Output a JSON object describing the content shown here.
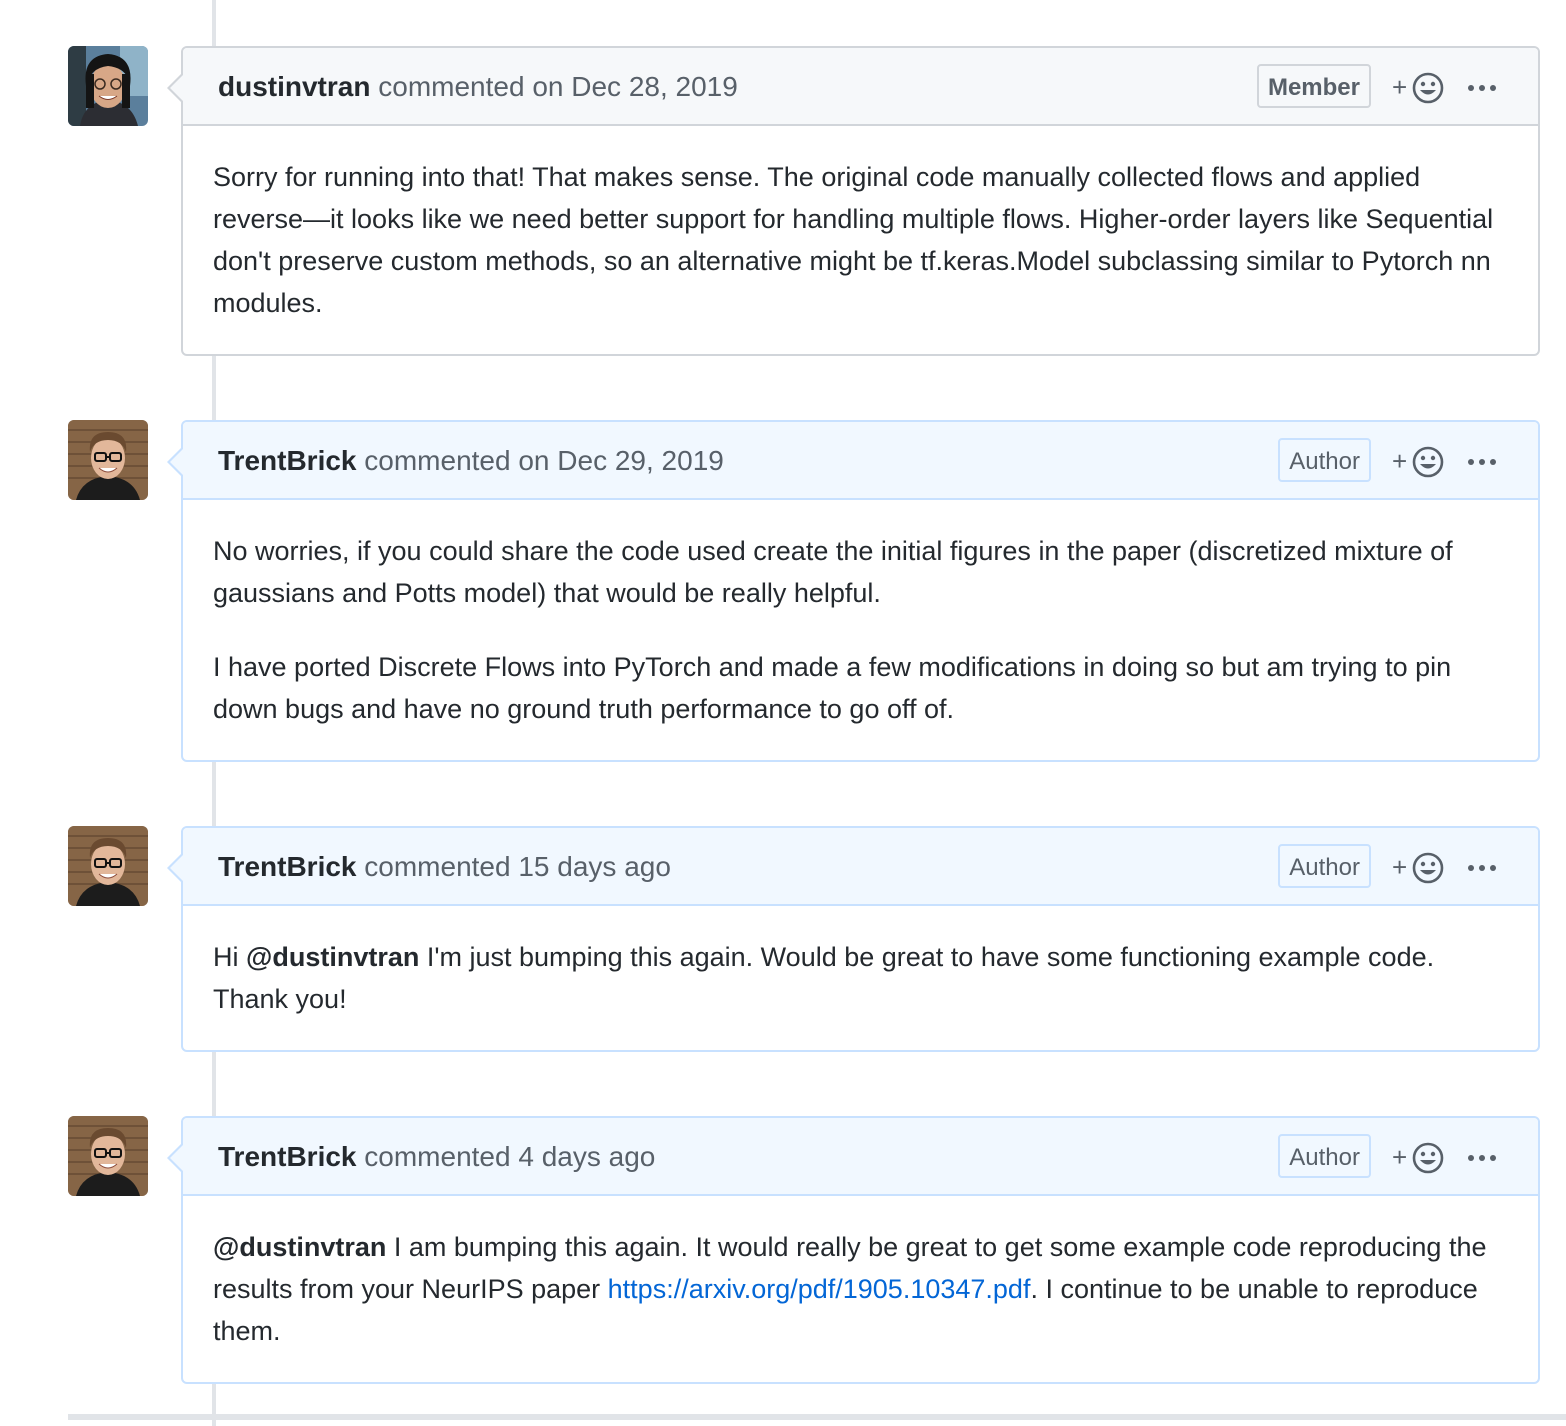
{
  "comments": [
    {
      "username": "dustinvtran",
      "action": "commented on",
      "date": "Dec 28, 2019",
      "role": "Member",
      "paragraphs": [
        "Sorry for running into that! That makes sense. The original code manually collected flows and applied reverse—it looks like we need better support for handling multiple flows. Higher-order layers like Sequential don't preserve custom methods, so an alternative might be tf.keras.Model subclassing similar to Pytorch nn modules."
      ]
    },
    {
      "username": "TrentBrick",
      "action": "commented on",
      "date": "Dec 29, 2019",
      "role": "Author",
      "paragraphs": [
        "No worries, if you could share the code used create the initial figures in the paper (discretized mixture of gaussians and Potts model) that would be really helpful.",
        "I have ported Discrete Flows into PyTorch and made a few modifications in doing so but am trying to pin down bugs and have no ground truth performance to go off of."
      ]
    },
    {
      "username": "TrentBrick",
      "action": "commented",
      "date": "15 days ago",
      "role": "Author",
      "greeting": "Hi",
      "mention": "@dustinvtran",
      "text": " I'm just bumping this again. Would be great to have some functioning example code. Thank you!"
    },
    {
      "username": "TrentBrick",
      "action": "commented",
      "date": "4 days ago",
      "role": "Author",
      "mention": "@dustinvtran",
      "text_before_link": " I am bumping this again. It would really be great to get some example code reproducing the results from your NeurIPS paper ",
      "link": "https://arxiv.org/pdf/1905.10347.pdf",
      "text_after_link": ". I continue to be unable to reproduce them."
    }
  ],
  "icons": {
    "reaction": "smiley-plus-icon",
    "more": "kebab-horizontal-icon"
  },
  "colors": {
    "link": "#0366d6",
    "member_header_bg": "#f6f8fa",
    "author_header_bg": "#f1f8ff",
    "author_border": "#c8e1ff"
  }
}
